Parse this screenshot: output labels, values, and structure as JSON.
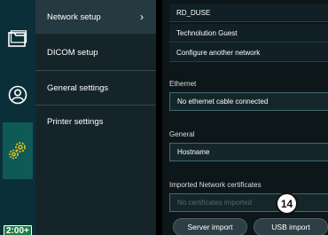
{
  "sidebar": {
    "time": "2:00+",
    "icons": [
      "files-icon",
      "user-icon",
      "settings-gears-icon"
    ]
  },
  "menu": {
    "items": [
      {
        "label": "Network setup"
      },
      {
        "label": "DICOM setup"
      },
      {
        "label": "General settings"
      },
      {
        "label": "Printer settings"
      }
    ]
  },
  "wifi": {
    "networks": [
      "RD_DUSE",
      "Technolution Guest",
      "Configure another network"
    ]
  },
  "ethernet": {
    "label": "Ethernet",
    "status": "No ethernet cable connected"
  },
  "general": {
    "label": "General",
    "hostname": "Hostname"
  },
  "certificates": {
    "label": "Imported Network certificates",
    "placeholder": "No certificates imported",
    "server_import": "Server import",
    "usb_import": "USB import"
  },
  "callout": "14",
  "colors": {
    "accent": "#0f5a57",
    "panel": "#152429",
    "time_chip": "#1f7a48"
  }
}
